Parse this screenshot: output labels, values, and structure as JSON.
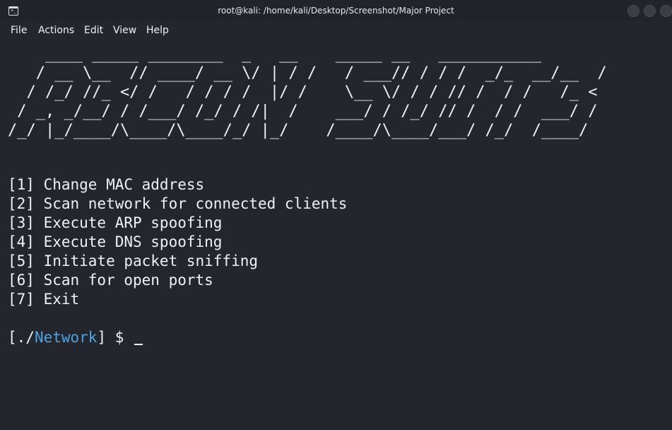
{
  "window": {
    "title": "root@kali: /home/kali/Desktop/Screenshot/Major Project",
    "icon": "terminal-icon"
  },
  "menu": {
    "items": [
      "File",
      "Actions",
      "Edit",
      "View",
      "Help"
    ]
  },
  "terminal": {
    "banner_lines": [
      "    ____ _____ ________  _   __    _____ __   ___________",
      "   / __ \\__  // ____/ __ \\/ | / /   / ___// / / /  _/_  __/__  /",
      "  / /_/ //_ </ /   / / / /  |/ /    \\__ \\/ / / // /  / /   /_ <",
      " / _, _/__/ / /___/ /_/ / /|  /    ___/ / /_/ // /  / /  ___/ /",
      "/_/ |_/____/\\____/\\____/_/ |_/    /____/\\____/___/ /_/  /____/"
    ],
    "options": [
      "[1] Change MAC address",
      "[2] Scan network for connected clients",
      "[3] Execute ARP spoofing",
      "[4] Execute DNS spoofing",
      "[5] Initiate packet sniffing",
      "[6] Scan for open ports",
      "[7] Exit"
    ],
    "prompt": {
      "prefix": "[./",
      "dir": "Network",
      "suffix": "] $ "
    }
  },
  "colors": {
    "background": "#24262e",
    "text": "#f0f1f5",
    "prompt_dir": "#4fa3df"
  }
}
